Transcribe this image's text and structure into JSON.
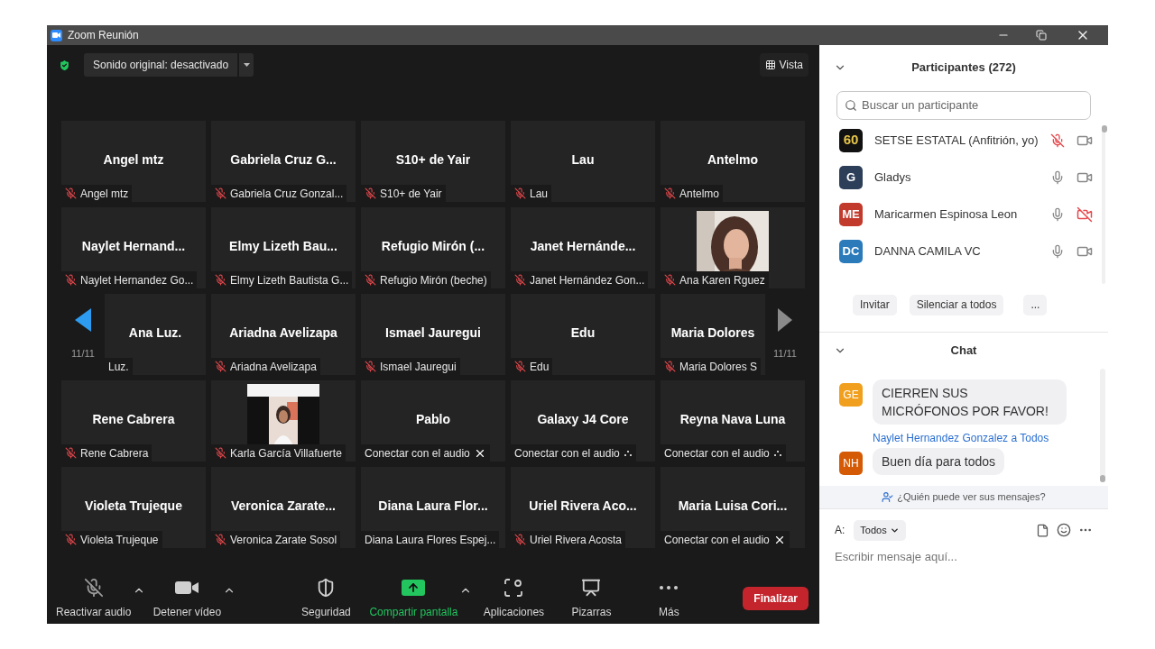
{
  "window": {
    "title": "Zoom Reunión"
  },
  "top_bar": {
    "sound_button": "Sonido original: desactivado",
    "view_button": "Vista"
  },
  "grid": {
    "rows": [
      {
        "kind": "plain",
        "tiles": [
          {
            "name": "Angel mtz",
            "label": "Angel mtz",
            "kind": "muted",
            "video_on": false
          },
          {
            "name": "Gabriela Cruz G...",
            "label": "Gabriela Cruz Gonzal...",
            "kind": "muted",
            "video_on": false
          },
          {
            "name": "S10+ de Yair",
            "label": "S10+ de Yair",
            "kind": "muted",
            "video_on": false
          },
          {
            "name": "Lau",
            "label": "Lau",
            "kind": "muted",
            "video_on": false
          },
          {
            "name": "Antelmo",
            "label": "Antelmo",
            "kind": "muted",
            "video_on": false
          }
        ]
      },
      {
        "kind": "plain",
        "tiles": [
          {
            "name": "Naylet Hernand...",
            "label": "Naylet Hernandez Go...",
            "kind": "muted",
            "video_on": false
          },
          {
            "name": "Elmy Lizeth Bau...",
            "label": "Elmy Lizeth Bautista G...",
            "kind": "muted",
            "video_on": false
          },
          {
            "name": "Refugio Mirón (...",
            "label": "Refugio Mirón (beche)",
            "kind": "muted",
            "video_on": false
          },
          {
            "name": "Janet Hernánde...",
            "label": "Janet Hernández Gon...",
            "kind": "muted",
            "video_on": false
          },
          {
            "label": "Ana Karen Rguez",
            "kind": "muted",
            "video_on": true
          }
        ]
      },
      {
        "kind": "carousel",
        "prev_page": "11/11",
        "next_page": "11/11",
        "tiles": [
          {
            "name": "Ana Luz.",
            "label": "Luz.",
            "kind": "plain",
            "video_on": false
          },
          {
            "name": "Ariadna Avelizapa",
            "label": "Ariadna Avelizapa",
            "kind": "muted",
            "video_on": false
          },
          {
            "name": "Ismael Jauregui",
            "label": "Ismael Jauregui",
            "kind": "muted",
            "video_on": false
          },
          {
            "name": "Edu",
            "label": "Edu",
            "kind": "muted",
            "video_on": false
          },
          {
            "name": "Maria Dolores",
            "label": "Maria Dolores S",
            "kind": "muted",
            "video_on": false
          }
        ]
      },
      {
        "kind": "plain",
        "tiles": [
          {
            "name": "Rene Cabrera",
            "label": "Rene Cabrera",
            "kind": "muted",
            "video_on": false
          },
          {
            "label": "Karla García Villafuerte",
            "kind": "muted",
            "video_on": true
          },
          {
            "name": "Pablo",
            "label": "Conectar con el audio",
            "kind": "connect_close",
            "video_on": false
          },
          {
            "name": "Galaxy J4 Core",
            "label": "Conectar con el audio",
            "kind": "connect_dots",
            "video_on": false
          },
          {
            "name": "Reyna Nava Luna",
            "label": "Conectar con el audio",
            "kind": "connect_dots",
            "video_on": false
          }
        ]
      },
      {
        "kind": "plain",
        "tiles": [
          {
            "name": "Violeta Trujeque",
            "label": "Violeta Trujeque",
            "kind": "muted",
            "video_on": false
          },
          {
            "name": "Veronica Zarate...",
            "label": "Veronica Zarate Sosol",
            "kind": "muted",
            "video_on": false
          },
          {
            "name": "Diana Laura Flor...",
            "label": "Diana Laura Flores Espej...",
            "kind": "plain",
            "video_on": false
          },
          {
            "name": "Uriel Rivera Aco...",
            "label": "Uriel Rivera Acosta",
            "kind": "muted",
            "video_on": false
          },
          {
            "name": "Maria Luisa Cori...",
            "label": "Conectar con el audio",
            "kind": "connect_close",
            "video_on": false
          }
        ]
      }
    ]
  },
  "toolbar": {
    "items": [
      {
        "kind": "mic_off",
        "label": "Reactivar audio",
        "caret": true,
        "highlighted": false
      },
      {
        "kind": "video",
        "label": "Detener vídeo",
        "caret": true,
        "highlighted": false
      },
      {
        "kind": "shield",
        "label": "Seguridad",
        "caret": false,
        "highlighted": false
      },
      {
        "kind": "share",
        "label": "Compartir pantalla",
        "caret": true,
        "highlighted": true
      },
      {
        "kind": "apps",
        "label": "Aplicaciones",
        "caret": false,
        "highlighted": false
      },
      {
        "kind": "whiteboard",
        "label": "Pizarras",
        "caret": false,
        "highlighted": false
      },
      {
        "kind": "more",
        "label": "Más",
        "caret": false,
        "highlighted": false
      }
    ],
    "end_button": "Finalizar"
  },
  "participants": {
    "title": "Participantes (272)",
    "search": {
      "placeholder": "Buscar un participante"
    },
    "items": [
      {
        "name": "SETSE ESTATAL (Anfitrión, yo)",
        "avatar": {
          "kind": "logo",
          "text": "60"
        },
        "muted": true,
        "video_off": false
      },
      {
        "name": "Gladys",
        "avatar": {
          "kind": "initials",
          "text": "G",
          "color": "#2c3e58"
        },
        "muted": false,
        "video_off": false
      },
      {
        "name": "Maricarmen Espinosa Leon",
        "avatar": {
          "kind": "initials",
          "text": "ME",
          "color": "#c23a2c"
        },
        "muted": false,
        "video_off": true
      },
      {
        "name": "DANNA CAMILA VC",
        "avatar": {
          "kind": "initials",
          "text": "DC",
          "color": "#2b7bbb"
        },
        "muted": false,
        "video_off": false
      }
    ],
    "buttons": [
      "Invitar",
      "Silenciar a todos",
      "..."
    ]
  },
  "chat": {
    "title": "Chat",
    "messages": [
      {
        "initials": "GE",
        "color": "#f0a01e",
        "text": "CIERREN SUS MICRÓFONOS POR FAVOR!"
      },
      {
        "header": "Naylet Hernandez Gonzalez a Todos",
        "initials": "NH",
        "color": "#d55a06",
        "text": "Buen día para todos"
      }
    ],
    "notice": "¿Quién puede ver sus mensajes?",
    "to_label": "A:",
    "recipient": "Todos",
    "input": {
      "placeholder": "Escribir mensaje aquí..."
    }
  }
}
